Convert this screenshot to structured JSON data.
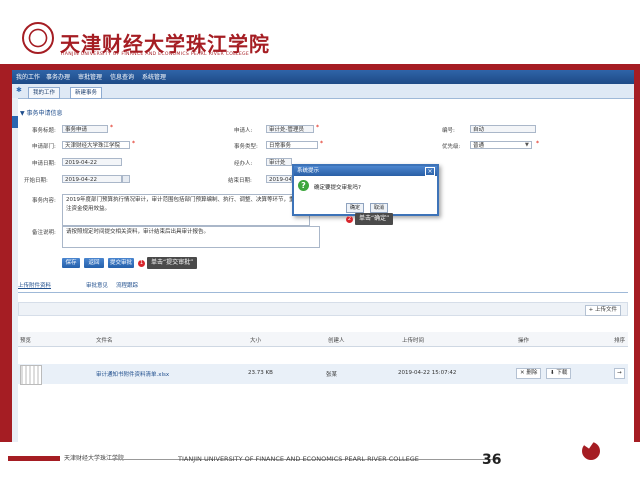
{
  "header": {
    "logo_cn": "天津财经大学珠江学院",
    "logo_en": "TIANJIN UNIVERSITY OF FINANCE AND ECONOMICS PEARL RIVER COLLEGE",
    "brand_color": "#a51d23"
  },
  "topnav": {
    "items": [
      "我的工作",
      "事务办理",
      "审批管理",
      "信息查询",
      "系统管理"
    ]
  },
  "tabs": [
    "我的工作",
    "新建事务"
  ],
  "form": {
    "section_title": "事务申请信息",
    "labels": {
      "title": "事务标题:",
      "applicant": "申请人:",
      "number": "编号:",
      "dept": "申请部门:",
      "category": "事务类型:",
      "priority": "优先级:",
      "apply_date": "申请日期:",
      "handler": "经办人:",
      "start_date": "开始日期:",
      "end_date": "结束日期:",
      "content": "事务内容:",
      "remark": "备注说明:"
    },
    "values": {
      "title": "事务申请",
      "applicant": "审计处-管理员",
      "number": "自动",
      "dept": "天津财经大学珠江学院",
      "category": "日常事务",
      "priority": "普通",
      "apply_date": "2019-04-22",
      "handler": "审计处",
      "start_date": "2019-04-22",
      "end_date": "2019-04-22"
    },
    "content": "2019年度部门预算执行情况审计，审计范围包括部门预算编制、执行、调整、决算等环节，重点关注资金使用效益。",
    "remark": "请按照规定时间提交相关资料，审计结束后出具审计报告。",
    "buttons": [
      "保存",
      "返回",
      "提交审批"
    ]
  },
  "annotations": {
    "step1_num": "1",
    "step1_text": "单击“提交审批”",
    "step2_num": "2",
    "step2_text": "单击“确定”"
  },
  "subtabs": [
    "上传附件资料",
    "审批意见",
    "流程跟踪"
  ],
  "toolbar": {
    "upload_label": "+ 上传文件"
  },
  "grid": {
    "columns": [
      "预览",
      "文件名",
      "大小",
      "创建人",
      "上传时间",
      "操作",
      "排序"
    ],
    "rows": [
      {
        "filename": "审计通知书附件资料清单.xlsx",
        "size": "23.73 KB",
        "creator": "张某",
        "time": "2019-04-22 15:07:42",
        "ops": [
          "删除",
          "下载"
        ]
      }
    ]
  },
  "dialog": {
    "title": "系统提示",
    "message": "确定要提交审批吗?",
    "ok_label": "确定",
    "cancel_label": "取消",
    "close_glyph": "×",
    "icon_glyph": "?"
  },
  "footer": {
    "cn": "天津财经大学珠江学院",
    "en": "TIANJIN UNIVERSITY OF FINANCE AND ECONOMICS PEARL RIVER COLLEGE",
    "page": "36"
  }
}
